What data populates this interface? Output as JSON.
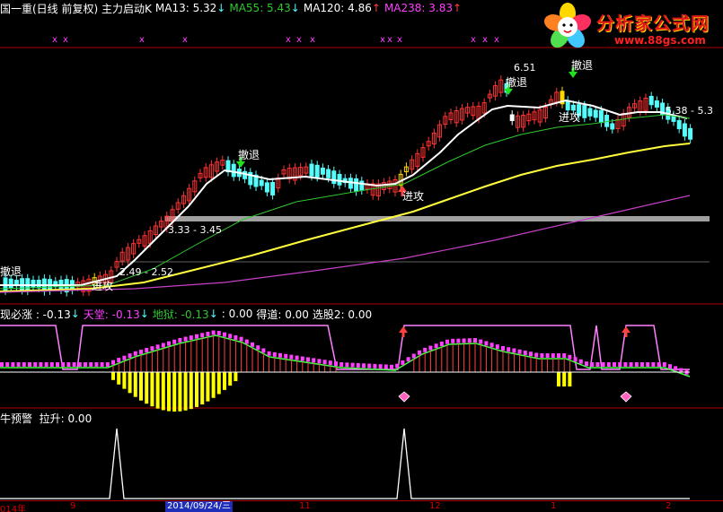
{
  "colors": {
    "background": "#000000",
    "up_candle": "#ff3232",
    "down_candle": "#54fcfc",
    "attack_candle": "#ffd800",
    "ma13": "#ffffff",
    "ma55": "#2ec82e",
    "ma120": "#ffff3c",
    "ma238": "#c840c8",
    "divider": "#b00000",
    "magenta_marker": "#ff40ff",
    "pink_line": "#ff80ff",
    "yellow_bar": "#ffff00",
    "red_bar": "#ff4040",
    "green_line": "#40ff40"
  },
  "main_header": {
    "title": "国一重(日线 前复权) 主力启动K",
    "ma13_label": "MA13: 5.32",
    "ma13_arrow": "↓",
    "ma55_label": "MA55: 5.43",
    "ma55_arrow": "↓",
    "ma120_label": "MA120: 4.86",
    "ma120_arrow": "↑",
    "ma238_label": "MA238: 3.83",
    "ma238_arrow": "↑"
  },
  "logo": {
    "name": "分析家公式网",
    "url_text": "www.88gs.com"
  },
  "main_chart": {
    "labels": {
      "retreat_1": "撤退",
      "retreat_2": "撤退",
      "retreat_3": "撤退",
      "retreat_4": "撤退",
      "attack_1": "进攻",
      "attack_2": "进攻",
      "attack_3": "进攻"
    },
    "high_label": "6.51",
    "range_top": "5.38 - 5.3",
    "range_mid": "3.33 - 3.45",
    "range_low": "2.49 - 2.52"
  },
  "indicator1_header": {
    "name_label": "现必涨 : -0.13",
    "name_arrow": "↓",
    "tiantang_label": "天堂: -0.13",
    "tiantang_arrow": "↓",
    "diyu_label": "地狱: -0.13",
    "diyu_arrow": "↓",
    "value_label": ": 0.00",
    "dedao_label": "得道: 0.00",
    "xuangu_label": "选股2: 0.00"
  },
  "indicator2_header": {
    "name_label": "牛预警  拉升: 0.00"
  },
  "time_axis": {
    "labels": [
      "014年",
      "9",
      "2014/09/24/三",
      "11",
      "12",
      "1",
      "2"
    ]
  },
  "chart_data": {
    "type": "candlestick",
    "title": "国一重(日线 前复权)",
    "indicator_names": [
      "MA13",
      "MA55",
      "MA120",
      "MA238"
    ],
    "indicator_values": [
      5.32,
      5.43,
      4.86,
      3.83
    ],
    "annotated_high": 6.51,
    "annotated_ranges": [
      [
        5.38,
        5.3
      ],
      [
        3.33,
        3.45
      ],
      [
        2.49,
        2.52
      ]
    ]
  }
}
